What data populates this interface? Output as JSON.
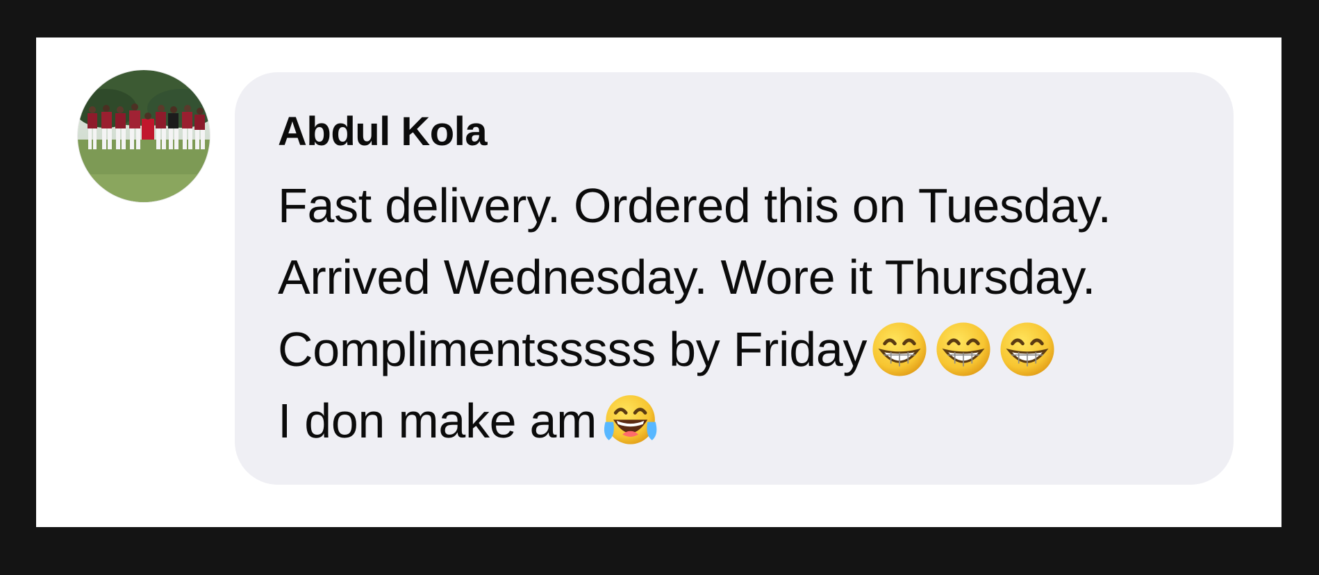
{
  "comment": {
    "author": "Abdul Kola",
    "lines": [
      "Fast delivery. Ordered this on Tuesday.",
      "Arrived Wednesday. Wore it Thursday.",
      "Complimentsssss by Friday",
      "I don make am"
    ],
    "emojis": {
      "line3": [
        "grinning-face-with-smiling-eyes",
        "grinning-face-with-smiling-eyes",
        "grinning-face-with-smiling-eyes"
      ],
      "line4": [
        "face-with-tears-of-joy"
      ]
    }
  },
  "colors": {
    "backdrop": "#141414",
    "card": "#ffffff",
    "bubble": "#efeff4",
    "text": "#0b0b0b"
  }
}
